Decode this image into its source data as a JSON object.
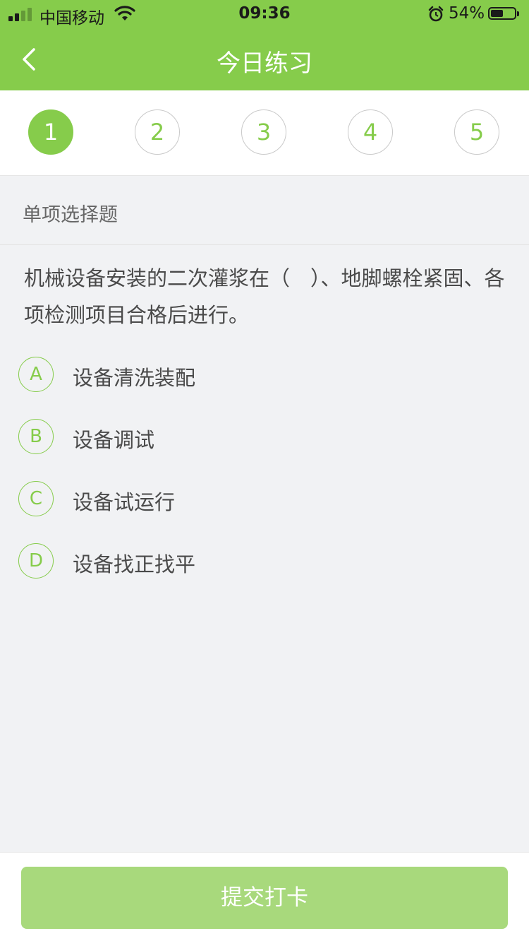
{
  "status_bar": {
    "carrier": "中国移动",
    "time": "09:36",
    "battery_percent": "54%"
  },
  "header": {
    "title": "今日练习",
    "back_icon": "chevron-left-icon"
  },
  "steps": {
    "items": [
      "1",
      "2",
      "3",
      "4",
      "5"
    ],
    "active_index": 0
  },
  "question": {
    "type": "单项选择题",
    "text": "机械设备安装的二次灌浆在（　）、地脚螺栓紧固、各项检测项目合格后进行。",
    "options": [
      {
        "letter": "A",
        "text": "设备清洗装配"
      },
      {
        "letter": "B",
        "text": "设备调试"
      },
      {
        "letter": "C",
        "text": "设备试运行"
      },
      {
        "letter": "D",
        "text": "设备找正找平"
      }
    ]
  },
  "footer": {
    "submit_label": "提交打卡"
  },
  "colors": {
    "accent": "#86cc4b",
    "button": "#a8d97c",
    "background": "#f1f2f4"
  }
}
